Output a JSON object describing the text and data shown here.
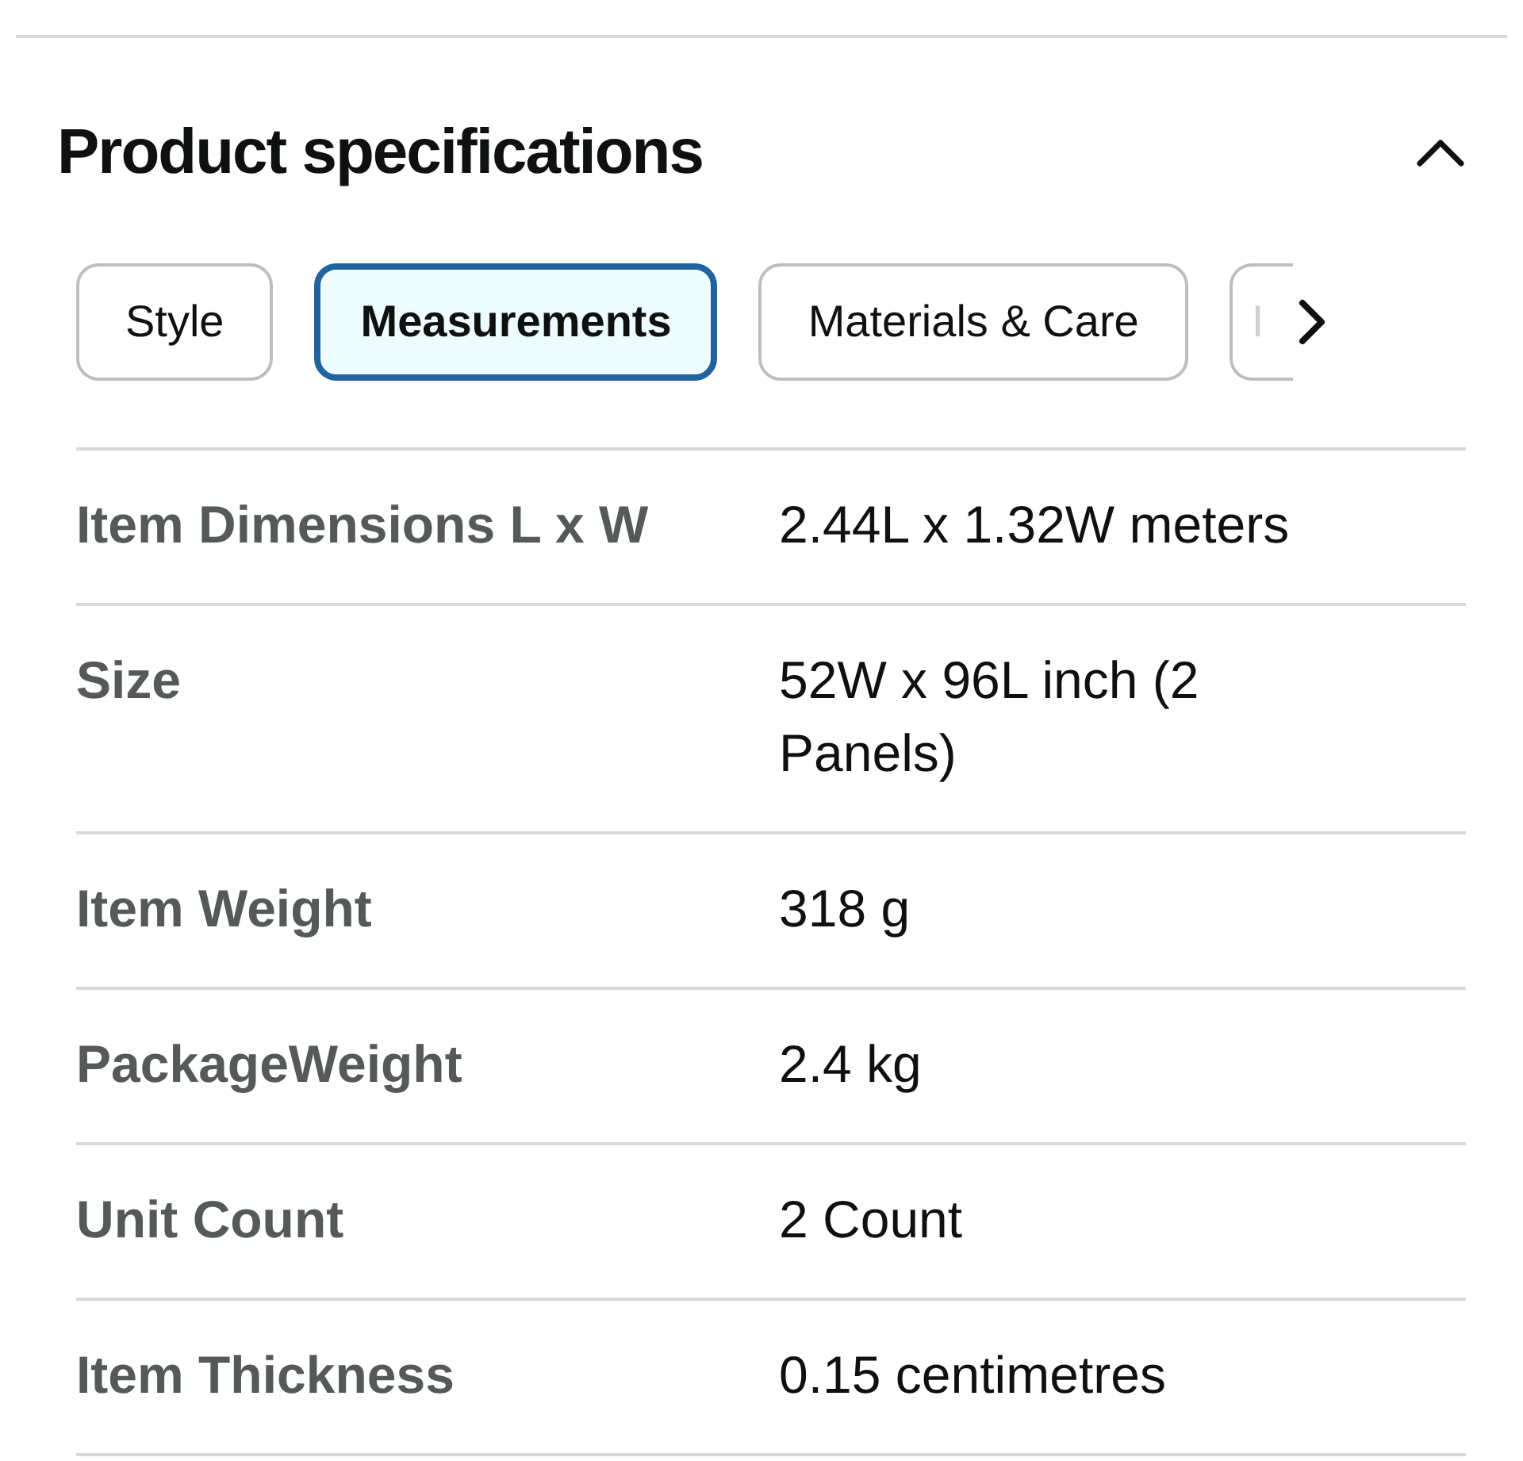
{
  "section": {
    "title": "Product specifications",
    "expanded": true
  },
  "tabs": [
    {
      "label": "Style",
      "selected": false
    },
    {
      "label": "Measurements",
      "selected": true
    },
    {
      "label": "Materials & Care",
      "selected": false
    },
    {
      "label": "I",
      "selected": false
    }
  ],
  "specs": [
    {
      "label": "Item Dimensions L x W",
      "value": "2.44L x 1.32W meters"
    },
    {
      "label": "Size",
      "value": "52W x 96L inch (2 Panels)"
    },
    {
      "label": "Item Weight",
      "value": "318 g"
    },
    {
      "label": "PackageWeight",
      "value": "2.4 kg"
    },
    {
      "label": "Unit Count",
      "value": "2 Count"
    },
    {
      "label": "Item Thickness",
      "value": "0.15 centimetres"
    }
  ]
}
